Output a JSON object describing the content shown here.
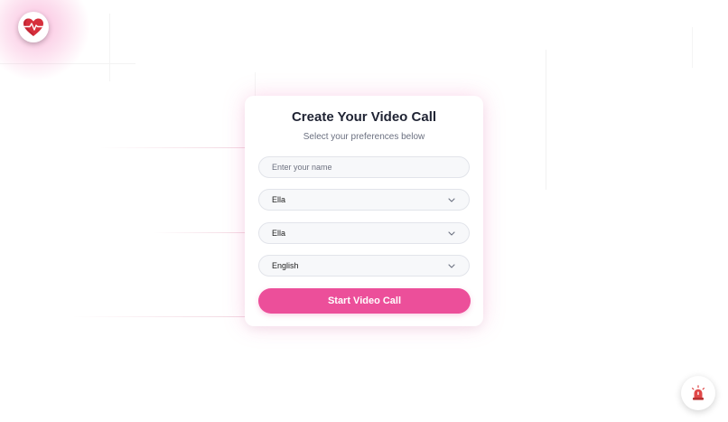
{
  "form": {
    "title": "Create Your Video Call",
    "subtitle": "Select your preferences below",
    "name_placeholder": "Enter your name",
    "name_value": "",
    "select_1_value": "Ella",
    "select_2_value": "Ella",
    "language_value": "English",
    "submit_label": "Start Video Call"
  },
  "icons": {
    "logo": "heart-pulse-icon",
    "select_arrow": "chevron-down-icon",
    "floating": "alarm-siren-icon"
  },
  "colors": {
    "accent": "#ec4f9a",
    "logo_red": "#d62f3c",
    "title": "#1f2333"
  }
}
